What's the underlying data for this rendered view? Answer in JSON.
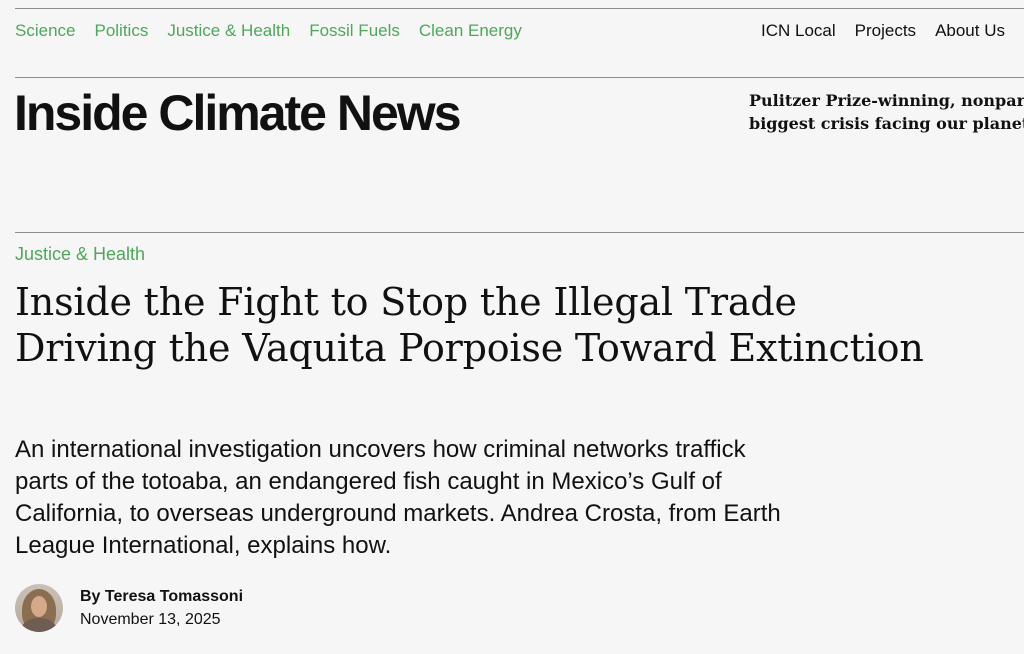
{
  "nav": {
    "left": [
      {
        "label": "Science"
      },
      {
        "label": "Politics"
      },
      {
        "label": "Justice & Health"
      },
      {
        "label": "Fossil Fuels"
      },
      {
        "label": "Clean Energy"
      }
    ],
    "right": [
      {
        "label": "ICN Local"
      },
      {
        "label": "Projects"
      },
      {
        "label": "About Us"
      }
    ]
  },
  "brand": {
    "title": "Inside Climate News",
    "tagline_lines": [
      "Pulitzer Prize-winning, nonparti",
      "biggest crisis facing our planet."
    ]
  },
  "article": {
    "category": "Justice & Health",
    "headline": "Inside the Fight to Stop the Illegal Trade Driving the Vaquita Porpoise Toward Extinction",
    "summary": "An international investigation uncovers how criminal networks traffick parts of the totoaba, an endangered fish caught in Mexico’s Gulf of California, to overseas underground markets. Andrea Crosta, from Earth League International, explains how.",
    "author": "By Teresa Tomassoni",
    "date": "November 13, 2025"
  },
  "colors": {
    "accent": "#4ea75a",
    "background": "#f6f6f6",
    "text": "#111111",
    "rule": "#8d8d8d"
  }
}
